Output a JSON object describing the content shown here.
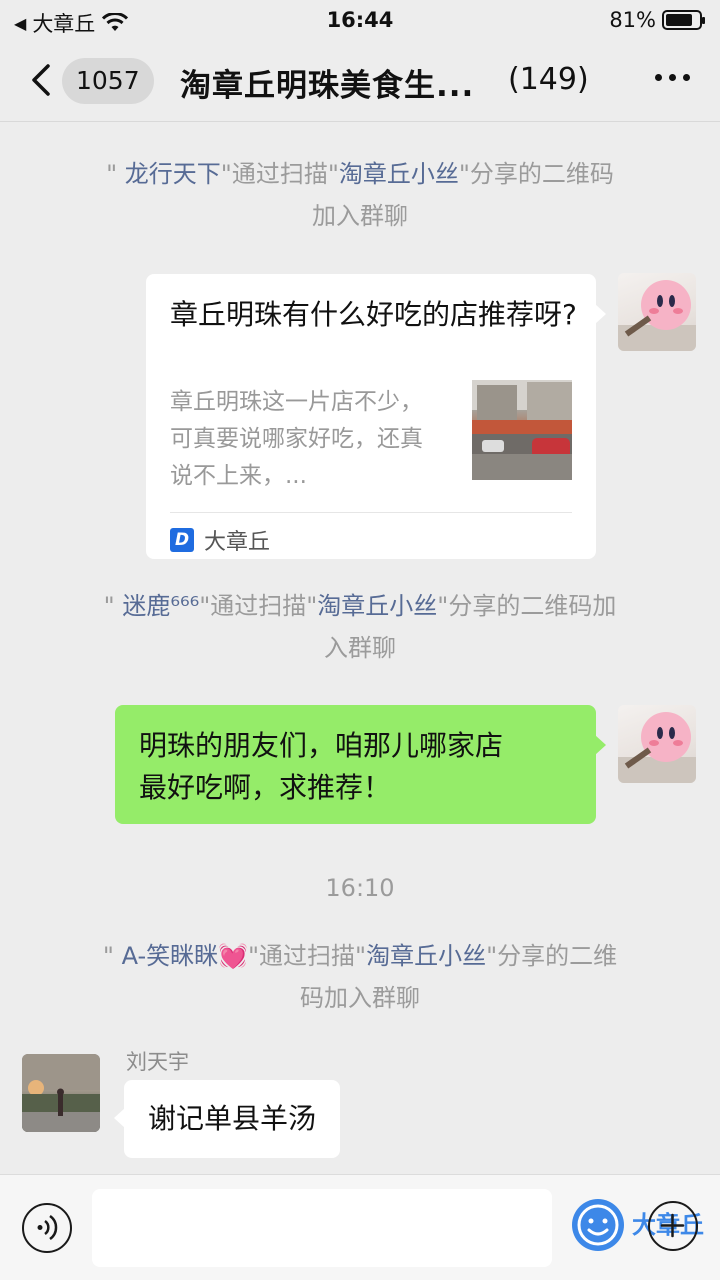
{
  "status_bar": {
    "back_app": "大章丘",
    "time": "16:44",
    "battery_text": "81%",
    "battery_level": 0.81
  },
  "nav": {
    "unread_count": "1057",
    "title": "淘章丘明珠美食生...",
    "member_count": "(149)"
  },
  "messages": {
    "sys1": {
      "q1": "\"",
      "name": "龙行天下",
      "mid": "\"通过扫描\"",
      "qr_owner": "淘章丘小丝",
      "tail": "\"分享的二维码",
      "line2": "加入群聊"
    },
    "card": {
      "title": "章丘明珠有什么好吃的店推荐呀?",
      "desc": "章丘明珠这一片店不少，可真要说哪家好吃，还真说不上来，...",
      "source": "大章丘",
      "source_logo_letter": "D"
    },
    "sys2": {
      "q1": "\"",
      "name": "迷鹿⁶⁶⁶",
      "mid": "\"通过扫描\"",
      "qr_owner": "淘章丘小丝",
      "tail": "\"分享的二维码加",
      "line2": "入群聊"
    },
    "green_bubble": {
      "line1": "明珠的朋友们，咱那儿哪家店",
      "line2": "最好吃啊，求推荐！"
    },
    "timestamp": "16:10",
    "sys3": {
      "q1": "\"",
      "name": "A-笑眯眯💓",
      "mid": "\"通过扫描\"",
      "qr_owner": "淘章丘小丝",
      "tail": "\"分享的二维",
      "line2": "码加入群聊"
    },
    "incoming": {
      "sender": "刘天宇",
      "text": "谢记单县羊汤"
    }
  },
  "input_bar": {
    "placeholder": "",
    "watermark": "大章丘"
  },
  "colors": {
    "background": "#ededed",
    "self_bubble": "#95ec69",
    "link_name": "#576b95",
    "system_text": "#9b9b9b",
    "brand_blue": "#3d88e8"
  },
  "icons": [
    "back-arrow-icon",
    "wifi-icon",
    "battery-icon",
    "more-icon",
    "voice-icon",
    "emoji-icon",
    "plus-icon",
    "source-logo-icon"
  ]
}
